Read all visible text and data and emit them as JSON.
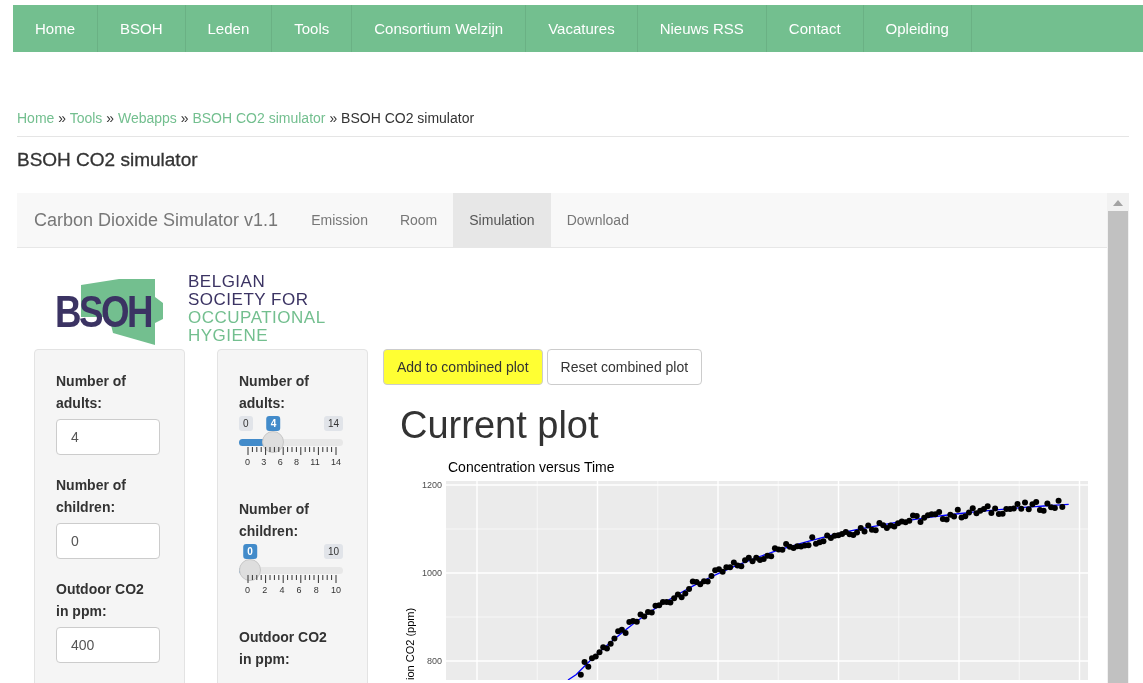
{
  "nav": [
    {
      "label": "Home"
    },
    {
      "label": "BSOH"
    },
    {
      "label": "Leden"
    },
    {
      "label": "Tools"
    },
    {
      "label": "Consortium Welzijn"
    },
    {
      "label": "Vacatures"
    },
    {
      "label": "Nieuws RSS"
    },
    {
      "label": "Contact"
    },
    {
      "label": "Opleiding"
    }
  ],
  "breadcrumb": [
    {
      "label": "Home",
      "kind": "link"
    },
    {
      "label": "»",
      "kind": "sep"
    },
    {
      "label": "Tools",
      "kind": "link"
    },
    {
      "label": "»",
      "kind": "sep"
    },
    {
      "label": "Webapps",
      "kind": "link"
    },
    {
      "label": "»",
      "kind": "sep"
    },
    {
      "label": "BSOH CO2 simulator",
      "kind": "link"
    },
    {
      "label": "»",
      "kind": "sep"
    },
    {
      "label": "BSOH CO2 simulator",
      "kind": "current"
    }
  ],
  "page_title": "BSOH CO2 simulator",
  "app": {
    "brand": "Carbon Dioxide Simulator v1.1",
    "tabs": [
      {
        "label": "Emission",
        "selected": false
      },
      {
        "label": "Room",
        "selected": false
      },
      {
        "label": "Simulation",
        "selected": true
      },
      {
        "label": "Download",
        "selected": false
      }
    ],
    "logo": {
      "mark": "BSOH",
      "lines": [
        {
          "text": "BELGIAN",
          "color": "#3b3363"
        },
        {
          "text": "SOCIETY FOR",
          "color": "#3b3363"
        },
        {
          "text": "OCCUPATIONAL",
          "color": "#73bf8f"
        },
        {
          "text": "HYGIENE",
          "color": "#73bf8f"
        }
      ]
    },
    "inputs": [
      {
        "label": "Number of adults:",
        "value": "4"
      },
      {
        "label": "Number of children:",
        "value": "0"
      },
      {
        "label": "Outdoor CO2 in ppm:",
        "value": "400"
      }
    ],
    "sliders": [
      {
        "label": "Number of adults:",
        "min": "0",
        "max": "14",
        "value": "4",
        "level": 0.286,
        "ticks": [
          "0",
          "3",
          "6",
          "8",
          "11",
          "14"
        ]
      },
      {
        "label": "Number of children:",
        "max": "10",
        "value": "0",
        "level": 0,
        "ticks": [
          "0",
          "2",
          "4",
          "6",
          "8",
          "10"
        ]
      }
    ],
    "slider_3_label": "Outdoor CO2 in ppm:",
    "buttons": [
      {
        "label": "Add to combined plot",
        "highlighted": true
      },
      {
        "label": "Reset combined plot",
        "highlighted": false
      }
    ],
    "plot_heading": "Current plot",
    "plot": {
      "title": "Concentration versus Time",
      "ylabel": "ion CO2 (ppm)",
      "yticks": [
        "1200",
        "1000",
        "800"
      ]
    }
  }
}
